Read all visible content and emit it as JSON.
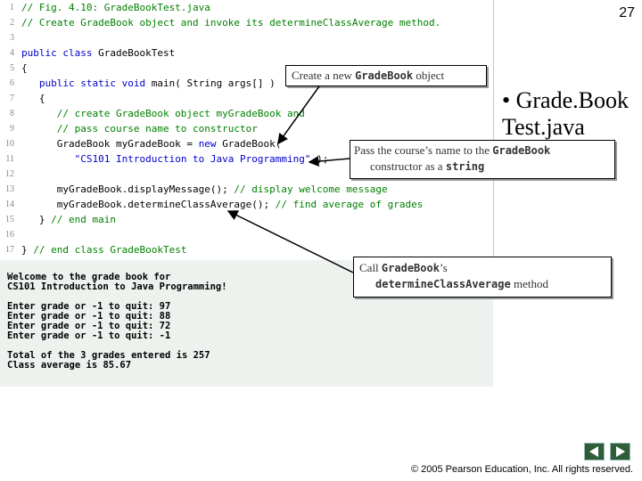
{
  "slide_number": "27",
  "bullet": "• Grade.Book Test.java",
  "code_lines": [
    {
      "n": "1",
      "parts": [
        {
          "t": "// Fig. 4.10: GradeBookTest.java",
          "c": "cm"
        }
      ]
    },
    {
      "n": "2",
      "parts": [
        {
          "t": "// Create GradeBook object and invoke its determineClassAverage method.",
          "c": "cm"
        }
      ]
    },
    {
      "n": "3",
      "parts": []
    },
    {
      "n": "4",
      "parts": [
        {
          "t": "public class ",
          "c": "kw"
        },
        {
          "t": "GradeBookTest",
          "c": "tx"
        }
      ]
    },
    {
      "n": "5",
      "parts": [
        {
          "t": "{",
          "c": "tx"
        }
      ]
    },
    {
      "n": "6",
      "parts": [
        {
          "t": "   ",
          "c": "tx"
        },
        {
          "t": "public static void ",
          "c": "kw"
        },
        {
          "t": "main( String args[] )",
          "c": "tx"
        }
      ]
    },
    {
      "n": "7",
      "parts": [
        {
          "t": "   {",
          "c": "tx"
        }
      ]
    },
    {
      "n": "8",
      "parts": [
        {
          "t": "      // create GradeBook object myGradeBook and",
          "c": "cm"
        }
      ]
    },
    {
      "n": "9",
      "parts": [
        {
          "t": "      // pass course name to constructor",
          "c": "cm"
        }
      ]
    },
    {
      "n": "10",
      "parts": [
        {
          "t": "      GradeBook myGradeBook = ",
          "c": "tx"
        },
        {
          "t": "new ",
          "c": "kw"
        },
        {
          "t": "GradeBook(",
          "c": "tx"
        }
      ]
    },
    {
      "n": "11",
      "parts": [
        {
          "t": "         ",
          "c": "tx"
        },
        {
          "t": "\"CS101 Introduction to Java Programming\"",
          "c": "st"
        },
        {
          "t": " );",
          "c": "tx"
        }
      ]
    },
    {
      "n": "12",
      "parts": []
    },
    {
      "n": "13",
      "parts": [
        {
          "t": "      myGradeBook.displayMessage(); ",
          "c": "tx"
        },
        {
          "t": "// display welcome message",
          "c": "cm"
        }
      ]
    },
    {
      "n": "14",
      "parts": [
        {
          "t": "      myGradeBook.determineClassAverage(); ",
          "c": "tx"
        },
        {
          "t": "// find average of grades",
          "c": "cm"
        }
      ]
    },
    {
      "n": "15",
      "parts": [
        {
          "t": "   } ",
          "c": "tx"
        },
        {
          "t": "// end main",
          "c": "cm"
        }
      ]
    },
    {
      "n": "16",
      "parts": []
    },
    {
      "n": "17",
      "parts": [
        {
          "t": "} ",
          "c": "tx"
        },
        {
          "t": "// end class GradeBookTest",
          "c": "cm"
        }
      ]
    }
  ],
  "output_lines": [
    "Welcome to the grade book for",
    "CS101 Introduction to Java Programming!",
    "",
    "Enter grade or -1 to quit: 97",
    "Enter grade or -1 to quit: 88",
    "Enter grade or -1 to quit: 72",
    "Enter grade or -1 to quit: -1",
    "",
    "Total of the 3 grades entered is 257",
    "Class average is 85.67"
  ],
  "callouts": {
    "create": {
      "pre": "Create a new ",
      "code": "GradeBook",
      "post": " object"
    },
    "pass": {
      "line1_pre": "Pass the course’s name to the ",
      "line1_code": "GradeBook",
      "line2_pre": "constructor as a ",
      "line2_code": "string"
    },
    "call": {
      "line1_pre": "Call ",
      "line1_code": "GradeBook",
      "line1_post": "’s",
      "line2_code": "determineClassAverage",
      "line2_post": " method"
    }
  },
  "navigation": {
    "prev_icon": "left-arrow-icon",
    "next_icon": "right-arrow-icon"
  },
  "footer": "© 2005 Pearson Education, Inc.  All rights reserved.",
  "colors": {
    "comment": "#008000",
    "keyword": "#0000cc",
    "output_bg": "#eef2ee",
    "nav_button": "#2f5d3a"
  }
}
